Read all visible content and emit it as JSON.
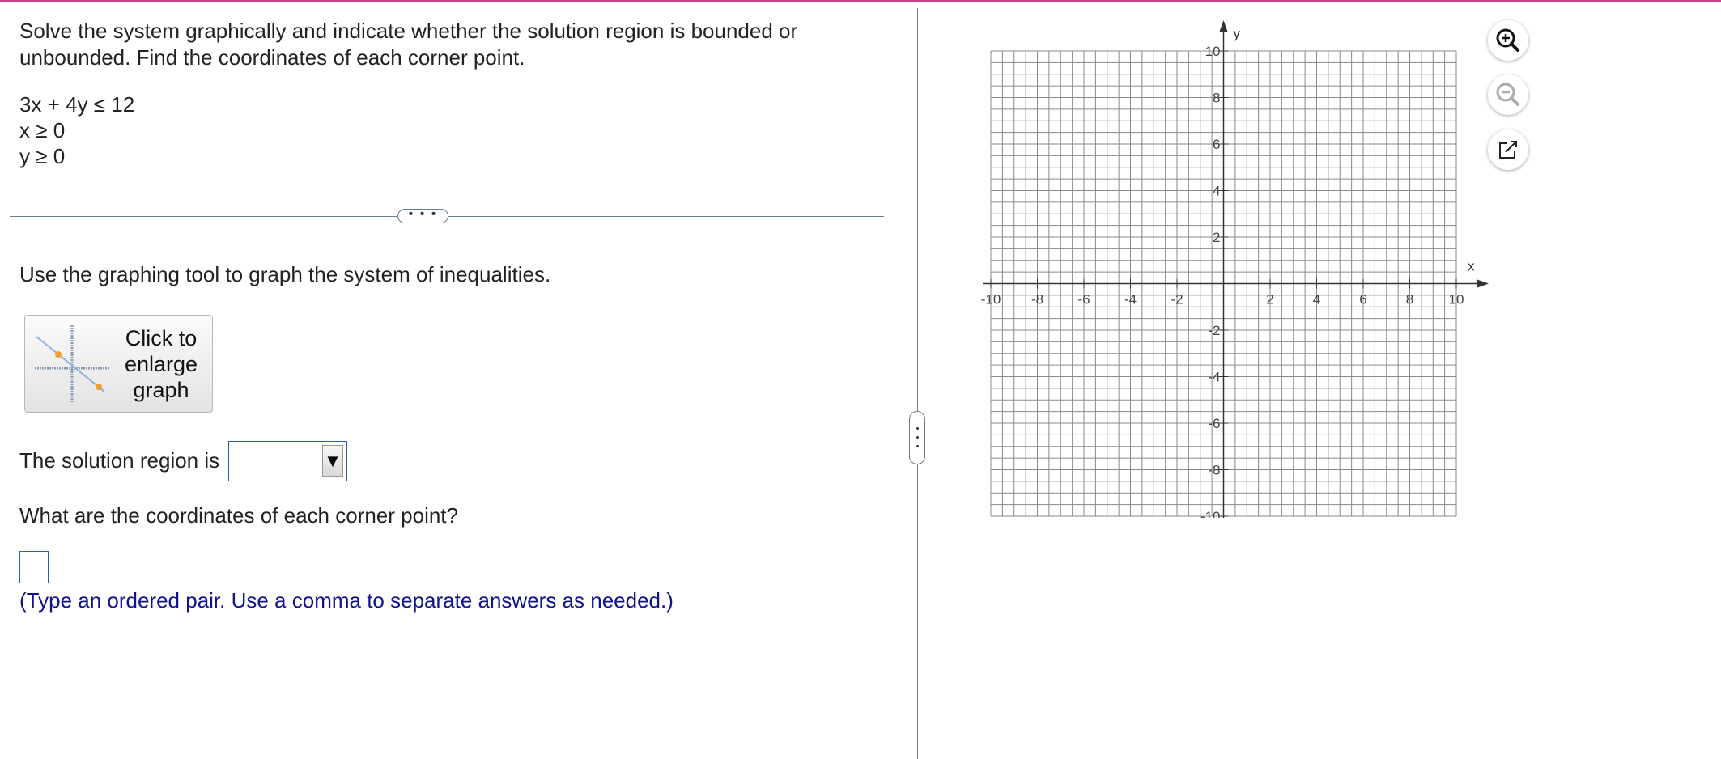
{
  "question": {
    "prompt": "Solve the system graphically and indicate whether the solution region is bounded or unbounded. Find the coordinates of each corner point.",
    "inequalities": [
      "3x + 4y ≤ 12",
      "x ≥ 0",
      "y ≥ 0"
    ],
    "more_button": "• • •",
    "instruction": "Use the graphing tool to graph the system of inequalities.",
    "enlarge_label": "Click to enlarge graph",
    "solution_label": "The solution region is",
    "solution_value": "",
    "corner_question": "What are the coordinates of each corner point?",
    "corner_answer": "",
    "hint": "(Type an ordered pair. Use a comma to separate answers as needed.)"
  },
  "graph": {
    "x_label": "x",
    "y_label": "y",
    "x_range": [
      -10,
      10
    ],
    "y_range": [
      -10,
      10
    ],
    "grid_step": 0.5,
    "label_step": 2,
    "x_tick_labels": [
      "-10",
      "-8",
      "-6",
      "-4",
      "-2",
      "2",
      "4",
      "6",
      "8",
      "10"
    ],
    "y_tick_labels": [
      "10",
      "8",
      "6",
      "4",
      "2",
      "-2",
      "-4",
      "-6",
      "-8",
      "-10"
    ]
  },
  "tools": {
    "zoom_in_icon": "zoom-in-icon",
    "zoom_out_icon": "zoom-out-icon",
    "popout_icon": "popout-icon"
  },
  "colors": {
    "accent_border": "#2d5fb0",
    "hint_text": "#12128f",
    "top_rule": "#c83c8a",
    "grid": "#8a8a8a"
  }
}
